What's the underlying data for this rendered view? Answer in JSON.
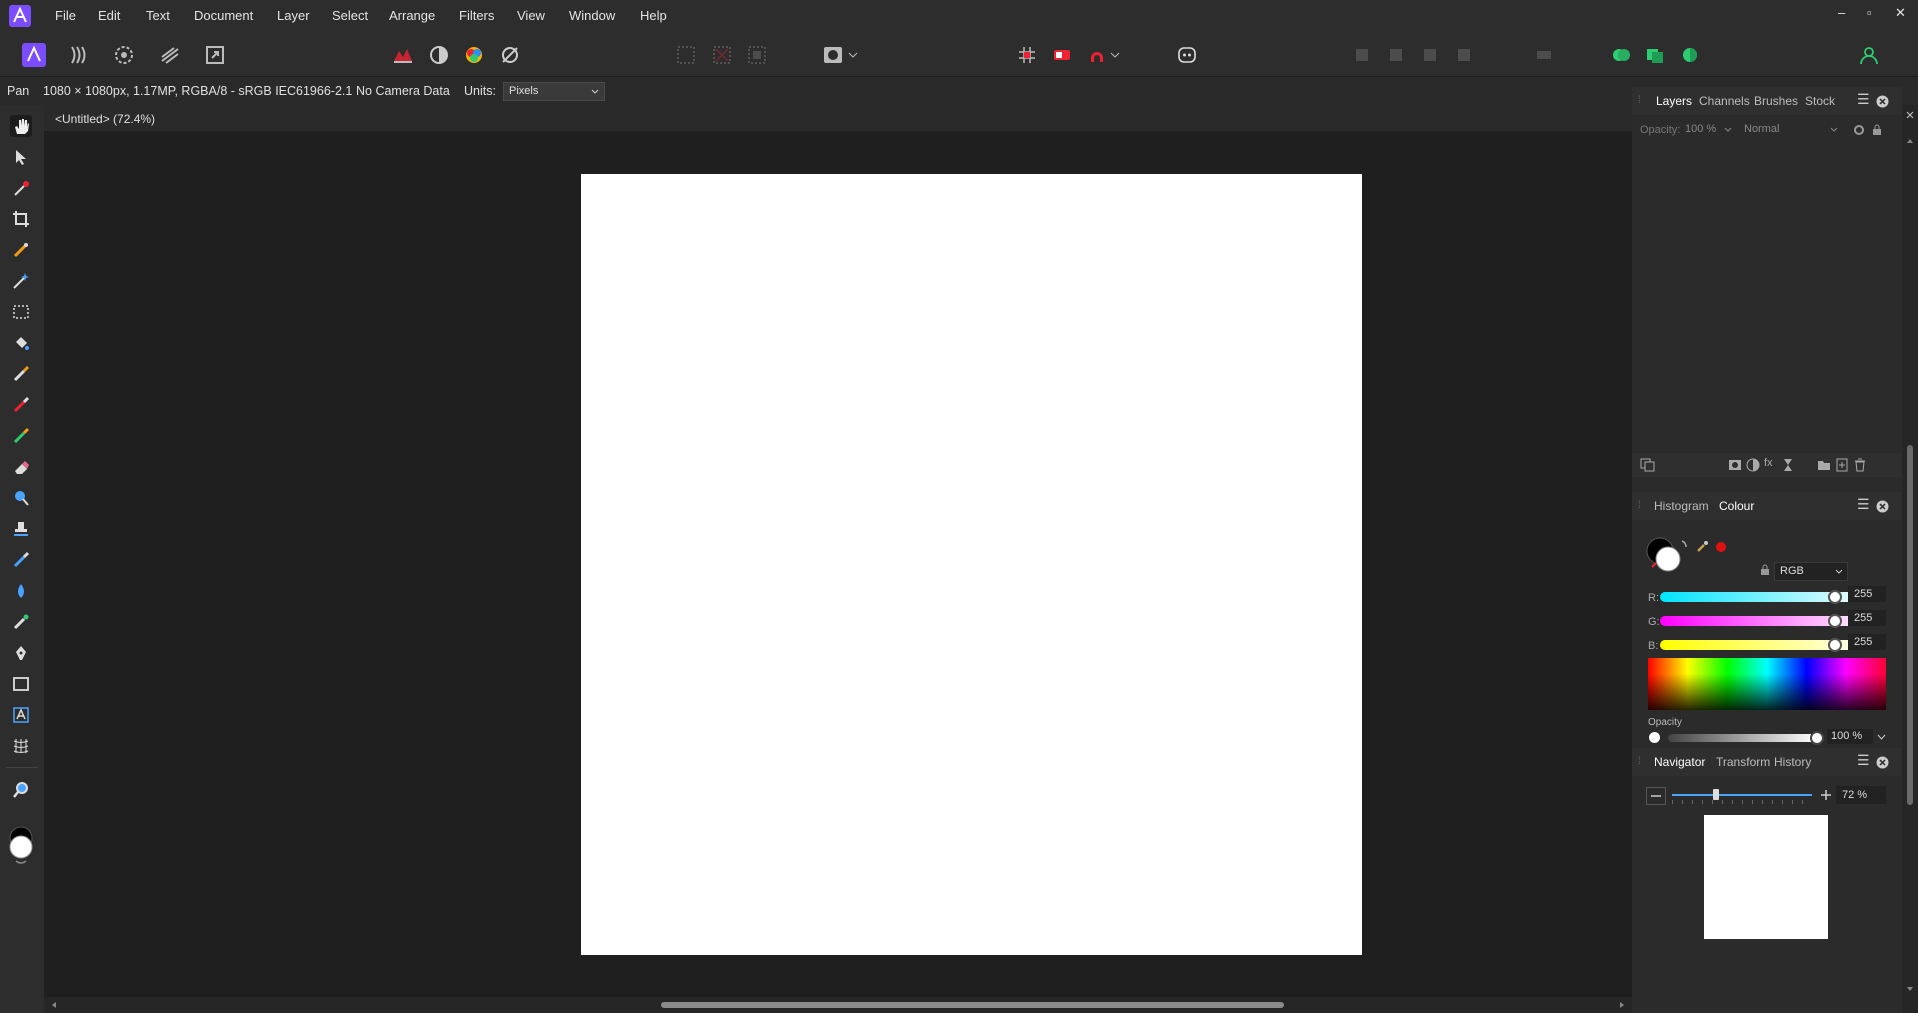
{
  "menu": [
    "File",
    "Edit",
    "Text",
    "Document",
    "Layer",
    "Select",
    "Arrange",
    "Filters",
    "View",
    "Window",
    "Help"
  ],
  "window_controls": {
    "minimize": "–",
    "restore": "▫",
    "close": "✕"
  },
  "context_bar": {
    "tool": "Pan",
    "doc_info": "1080 × 1080px, 1.17MP, RGBA/8 - sRGB IEC61966-2.1",
    "camera": "No Camera Data",
    "units_label": "Units:",
    "units_value": "Pixels"
  },
  "document_tab": "<Untitled> (72.4%)",
  "layers_panel": {
    "tabs": [
      "Layers",
      "Channels",
      "Brushes",
      "Stock"
    ],
    "active_tab": "Layers",
    "opacity_label": "Opacity:",
    "opacity_value": "100 %",
    "blend_mode": "Normal"
  },
  "colour_panel": {
    "tabs": [
      "Histogram",
      "Colour"
    ],
    "active_tab": "Colour",
    "model": "RGB",
    "r_label": "R:",
    "r_value": "255",
    "g_label": "G:",
    "g_value": "255",
    "b_label": "B:",
    "b_value": "255",
    "opacity_label": "Opacity",
    "opacity_value": "100 %"
  },
  "navigator_panel": {
    "tabs": [
      "Navigator",
      "Transform",
      "History"
    ],
    "active_tab": "Navigator",
    "zoom_value": "72 %"
  },
  "colors": {
    "accent": "#7b4dff",
    "app_bg": "#232323",
    "panel_bg": "#2b2b2b",
    "canvas": "#ffffff"
  }
}
